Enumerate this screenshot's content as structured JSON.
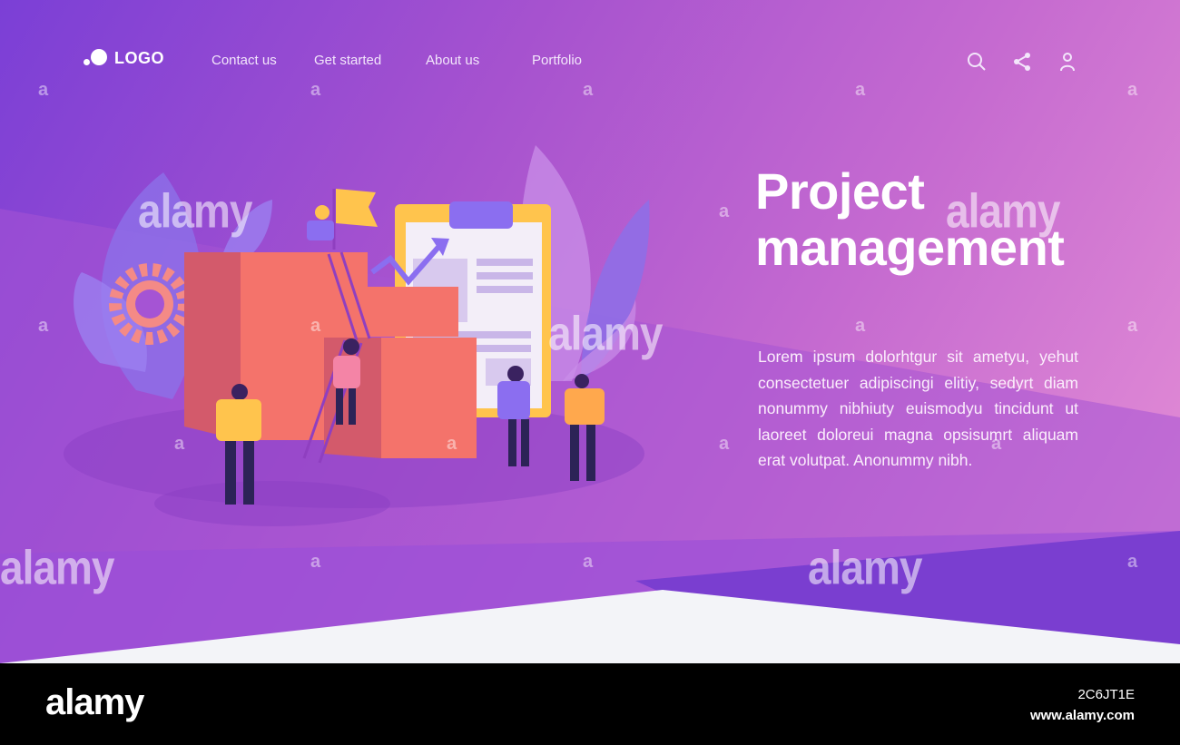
{
  "header": {
    "logo_text": "LOGO",
    "nav": [
      {
        "label": "Contact us"
      },
      {
        "label": "Get started"
      },
      {
        "label": "About us"
      },
      {
        "label": "Portfolio"
      }
    ],
    "icons": [
      "search-icon",
      "share-icon",
      "user-icon"
    ]
  },
  "hero": {
    "title_line1": "Project",
    "title_line2": "management",
    "description": "Lorem ipsum dolorhtgur sit ametyu, yehut consectetuer adipiscingi elitiy, sedyrt diam nonummy nibhiuty euismodyu tincidunt ut laoreet doloreui magna opsisumrt aliquam erat volutpat. Anonummy nibh."
  },
  "stock_bar": {
    "brand": "alamy",
    "image_id": "2C6JT1E",
    "url": "www.alamy.com"
  },
  "watermark": {
    "big": "alamy",
    "small": "a"
  },
  "colors": {
    "accent_purple": "#7b3fd6",
    "pink": "#e690d6",
    "illustration_coral": "#f4736b",
    "illustration_yellow": "#ffc44d"
  }
}
